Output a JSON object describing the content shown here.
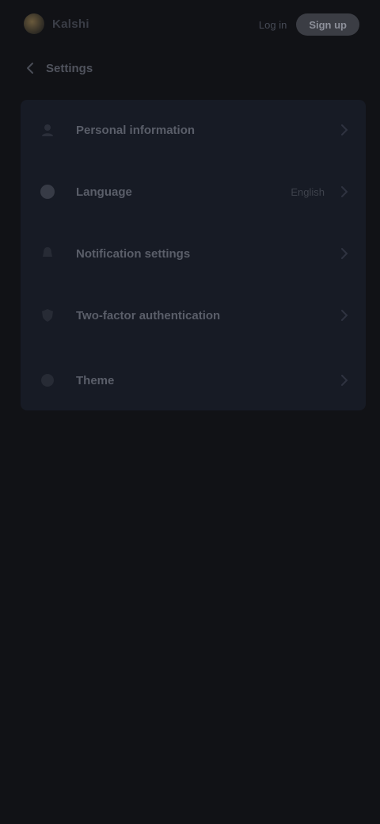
{
  "app": {
    "brand_name": "Kalshi",
    "login_label": "Log in",
    "signup_label": "Sign up"
  },
  "page": {
    "title": "Settings"
  },
  "settings": {
    "items": [
      {
        "label": "Personal information",
        "value": "",
        "icon": "user-icon"
      },
      {
        "label": "Language",
        "value": "English",
        "icon": "globe-icon"
      },
      {
        "label": "Notification settings",
        "value": "",
        "icon": "bell-icon"
      },
      {
        "label": "Two-factor authentication",
        "value": "",
        "icon": "shield-icon"
      },
      {
        "label": "Theme",
        "value": "",
        "icon": "palette-icon"
      }
    ]
  },
  "colors": {
    "background": "#111216",
    "card": "#171b25",
    "accent": "#6a5a3c"
  }
}
